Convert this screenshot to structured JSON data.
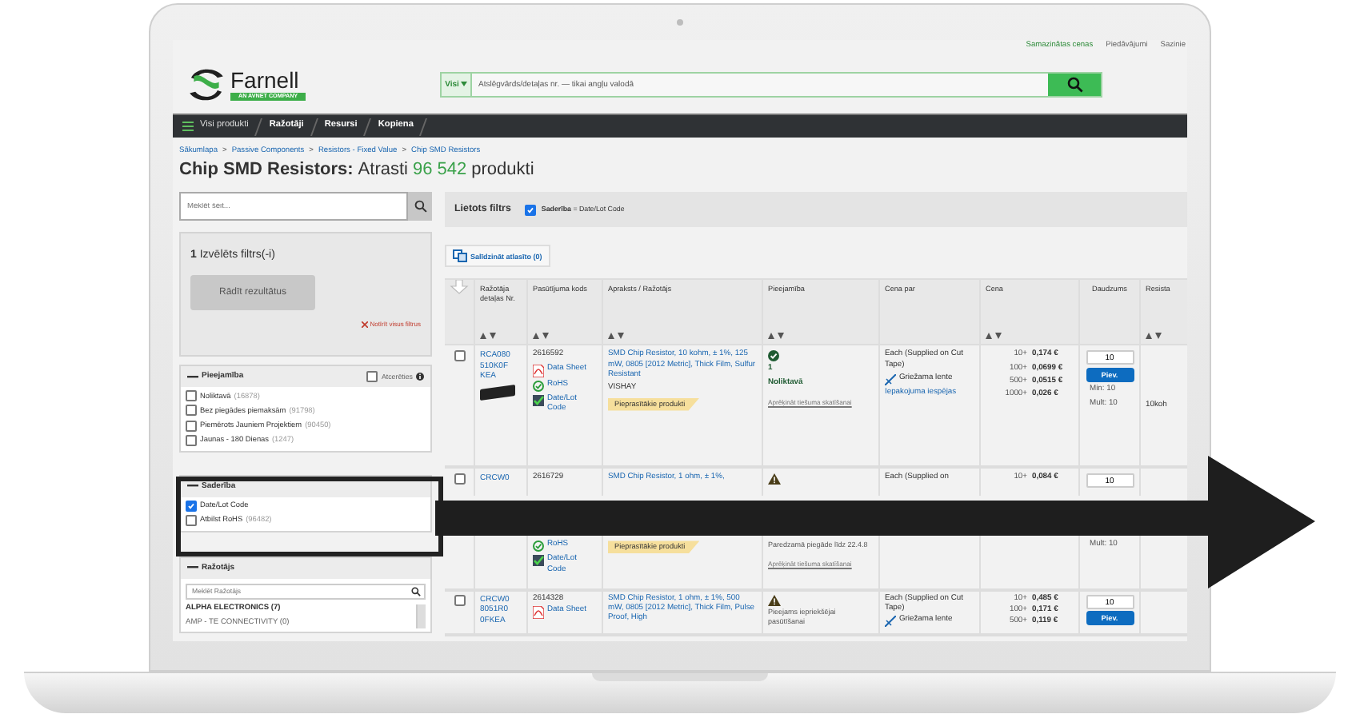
{
  "header": {
    "links": [
      {
        "label": "Samazinātas cenas",
        "selected": true
      },
      {
        "label": "Piedāvājumi",
        "selected": false
      },
      {
        "label": "Sazinie",
        "selected": false
      }
    ],
    "logo": {
      "name": "Farnell",
      "tagline": "AN AVNET COMPANY"
    },
    "search": {
      "scope": "Visi",
      "placeholder": "Atslēgvārds/detaļas nr. — tikai angļu valodā"
    }
  },
  "nav": [
    "Visi produkti",
    "Ražotāji",
    "Resursi",
    "Kopiena"
  ],
  "breadcrumb": {
    "separator": ">",
    "items": [
      "Sākumlapa",
      "Passive Components",
      "Resistors - Fixed Value",
      "Chip SMD Resistors"
    ]
  },
  "title": {
    "category": "Chip SMD Resistors:",
    "label": "Atrasti",
    "count": "96 542",
    "unit": "produkti"
  },
  "sidebar": {
    "search_placeholder": "Meklēt šeit...",
    "selected_filters": "**1** Izvēlēts filtrs(-i)",
    "show_button": "Rādīt rezultātus",
    "clear_link": "Notīrīt visus filtrus",
    "groups": [
      {
        "title": "Pieejamība",
        "remember": {
          "label": "Atcerēties",
          "checked": false
        },
        "options": [
          {
            "label": "Noliktavā",
            "count": "(16878)",
            "checked": false
          },
          {
            "label": "Bez piegādes piemaksām",
            "count": "(91798)",
            "checked": false
          },
          {
            "label": "Piemērots Jauniem Projektiem",
            "count": "(90450)",
            "checked": false
          },
          {
            "label": "Jaunas - 180 Dienas",
            "count": "(1247)",
            "checked": false
          }
        ]
      },
      {
        "title": "Saderība",
        "options": [
          {
            "label": "Date/Lot Code",
            "checked": true
          },
          {
            "label": "Atbilst RoHS",
            "count": "(96482)",
            "checked": false
          }
        ]
      },
      {
        "title": "Ražotājs",
        "search_placeholder": "Meklēt Ražotājs",
        "items": [
          "ALPHA ELECTRONICS (7)",
          "AMP - TE CONNECTIVITY (0)"
        ]
      }
    ]
  },
  "applied": {
    "title": "Lietots filtrs",
    "filter": {
      "label": "**Saderība** = Date/Lot Code",
      "checked": true
    }
  },
  "compare_button": "Salīdzināt atlasīto (0)",
  "table": {
    "columns": [
      {
        "label": "Ražotāja detaļas Nr.",
        "sortable": true
      },
      {
        "label": "Pasūtījuma kods",
        "sortable": true
      },
      {
        "label": "Apraksts / Ražotājs",
        "sortable": true
      },
      {
        "label": "Pieejamība",
        "sortable": true
      },
      {
        "label": "Cena par",
        "sortable": false
      },
      {
        "label": "Cena",
        "sortable": true
      },
      {
        "label": "Daudzums",
        "sortable": false
      },
      {
        "label": "Resista",
        "sortable": true
      }
    ],
    "rows": [
      {
        "segments": [
          {
            "select": [
              {
                "kind": "checkbox",
                "checked": false
              }
            ],
            "part_number": [
              {
                "kind": "part",
                "text": "RCA080510K0FKEA"
              },
              {
                "kind": "image"
              }
            ],
            "order_code": [
              {
                "kind": "text",
                "text": "2616592"
              },
              {
                "kind": "datasheet",
                "text": "Data Sheet"
              },
              {
                "kind": "rohs",
                "text": "RoHS"
              },
              {
                "kind": "datelot",
                "text": "Date/Lot Code"
              }
            ],
            "description": [
              {
                "kind": "link",
                "text": "SMD Chip Resistor, 10 kohm, ± 1%, 125 mW, 0805 [2012 Metric], Thick Film, Sulfur Resistant"
              },
              {
                "kind": "maker",
                "text": "VISHAY"
              },
              {
                "kind": "badge",
                "text": "Pieprasītākie produkti"
              }
            ],
            "availability": [
              {
                "kind": "instock"
              },
              {
                "kind": "stock",
                "text": "1"
              },
              {
                "kind": "stock",
                "text": "Noliktavā"
              },
              {
                "kind": "sublink",
                "text": "Aprēķināt tiešuma skatīšanai"
              }
            ],
            "price_for": [
              {
                "kind": "text",
                "text": "Each (Supplied on Cut Tape)"
              },
              {
                "kind": "tape",
                "text": "Griežama lente"
              },
              {
                "kind": "link",
                "text": "Iepakojuma iespējas"
              }
            ],
            "price": [
              {
                "kind": "price",
                "qty": "10+",
                "value": "0,174 €"
              },
              {
                "kind": "price",
                "qty": "100+",
                "value": "0,0699 €"
              },
              {
                "kind": "price",
                "qty": "500+",
                "value": "0,0515 €"
              },
              {
                "kind": "price",
                "qty": "1000+",
                "value": "0,026 €"
              }
            ],
            "quantity": [
              {
                "kind": "input",
                "value": "10"
              },
              {
                "kind": "button",
                "text": "Piev."
              },
              {
                "kind": "minor",
                "text": "Min: 10"
              },
              {
                "kind": "minor",
                "text": "Mult: 10"
              }
            ],
            "resistance": [
              {
                "kind": "value",
                "text": "10koh"
              }
            ]
          }
        ]
      },
      {
        "segments": [
          {
            "select": [
              {
                "kind": "checkbox",
                "checked": false
              }
            ],
            "part_number": [
              {
                "kind": "part",
                "text": "CRCW0"
              }
            ],
            "order_code": [
              {
                "kind": "text",
                "text": "2616729"
              }
            ],
            "description": [
              {
                "kind": "link",
                "text": "SMD Chip Resistor, 1 ohm, ± 1%,"
              }
            ],
            "availability": [
              {
                "kind": "warning"
              }
            ],
            "price_for": [
              {
                "kind": "text",
                "text": "Each (Supplied on"
              }
            ],
            "price": [
              {
                "kind": "price",
                "qty": "10+",
                "value": "0,084 €"
              }
            ],
            "quantity": [
              {
                "kind": "input",
                "value": "10"
              }
            ]
          },
          {
            "order_code": [
              {
                "kind": "rohs",
                "text": "RoHS"
              },
              {
                "kind": "datelot",
                "text": "Date/Lot Code"
              }
            ],
            "description": [
              {
                "kind": "badge",
                "text": "Pieprasītākie produkti"
              }
            ],
            "availability": [
              {
                "kind": "note",
                "text": "Paredzamā piegāde līdz 22.4.8"
              },
              {
                "kind": "sublink",
                "text": "Aprēķināt tiešuma skatīšanai"
              }
            ],
            "quantity": [
              {
                "kind": "minor",
                "text": "Mult: 10"
              }
            ]
          }
        ]
      },
      {
        "segments": [
          {
            "select": [
              {
                "kind": "checkbox",
                "checked": false
              }
            ],
            "part_number": [
              {
                "kind": "part",
                "text": "CRCW08051R00FKEA"
              }
            ],
            "order_code": [
              {
                "kind": "text",
                "text": "2614328"
              },
              {
                "kind": "datasheet",
                "text": "Data Sheet"
              }
            ],
            "description": [
              {
                "kind": "link",
                "text": "SMD Chip Resistor, 1 ohm, ± 1%, 500 mW, 0805 [2012 Metric], Thick Film, Pulse Proof, High"
              }
            ],
            "availability": [
              {
                "kind": "warning"
              },
              {
                "kind": "note",
                "text": "Pieejams iepriekšējai pasūtīšanai"
              }
            ],
            "price_for": [
              {
                "kind": "text",
                "text": "Each (Supplied on Cut Tape)"
              },
              {
                "kind": "tape",
                "text": "Griežama lente"
              }
            ],
            "price": [
              {
                "kind": "price",
                "qty": "10+",
                "value": "0,485 €"
              },
              {
                "kind": "price",
                "qty": "100+",
                "value": "0,171 €"
              },
              {
                "kind": "price",
                "qty": "500+",
                "value": "0,119 €"
              }
            ],
            "quantity": [
              {
                "kind": "input",
                "value": "10"
              },
              {
                "kind": "button",
                "text": "Piev."
              }
            ]
          }
        ]
      }
    ]
  }
}
